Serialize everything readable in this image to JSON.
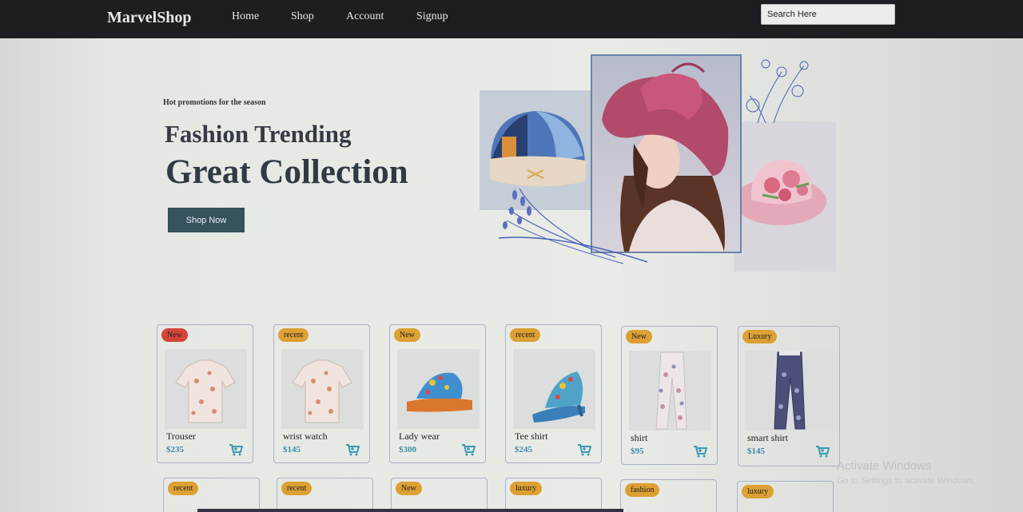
{
  "nav": {
    "logo": "MarvelShop",
    "links": [
      "Home",
      "Shop",
      "Account",
      "Signup"
    ],
    "search_placeholder": "Search Here"
  },
  "hero": {
    "promo": "Hot promotions for the season",
    "title_line1": "Fashion Trending",
    "title_line2": "Great Collection",
    "button": "Shop Now"
  },
  "products": [
    {
      "badge": "New",
      "name": "Trouser",
      "price": "$235",
      "image": "floral-shirt"
    },
    {
      "badge": "recent",
      "name": "wrist watch",
      "price": "$145",
      "image": "floral-shirt"
    },
    {
      "badge": "New",
      "name": "Lady wear",
      "price": "$300",
      "image": "floral-sandal"
    },
    {
      "badge": "recent",
      "name": "Tee shirt",
      "price": "$245",
      "image": "floral-sandal"
    },
    {
      "badge": "New",
      "name": "shirt",
      "price": "$95",
      "image": "floral-pants"
    },
    {
      "badge": "Luxury",
      "name": "smart shirt",
      "price": "$145",
      "image": "floral-pants"
    }
  ],
  "products_row2_badges": [
    "recent",
    "recent",
    "New",
    "luxury",
    "fashion",
    "luxury"
  ],
  "watermark": {
    "title": "Activate Windows",
    "subtitle": "Go to Settings to activate Windows."
  },
  "colors": {
    "nav_bg": "#1e1d22",
    "button_bg": "#35525d",
    "price": "#3d8ca8",
    "badge_orange": "#dca033",
    "badge_red": "#d34539"
  }
}
